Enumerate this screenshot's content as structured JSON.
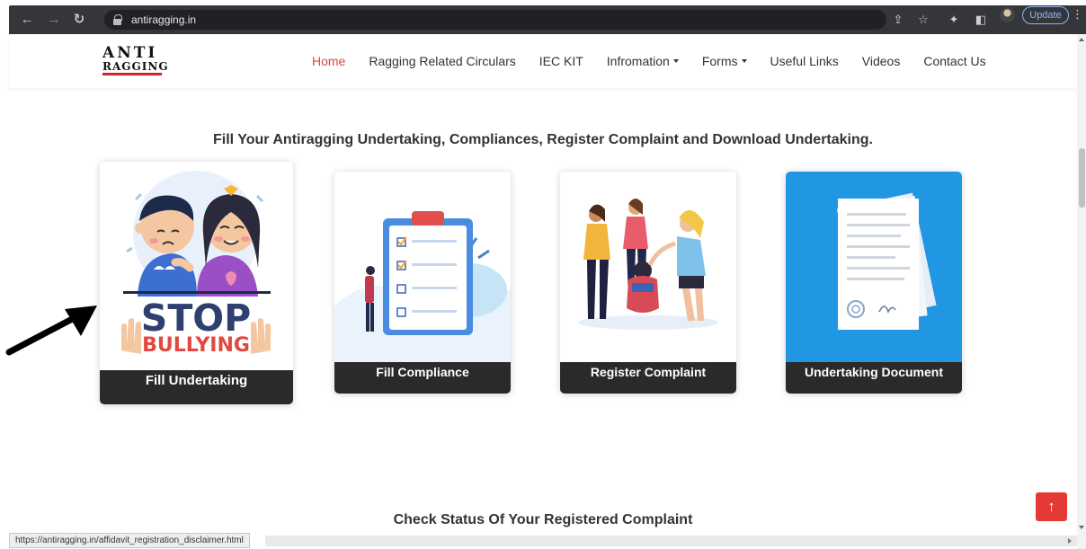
{
  "browser": {
    "url": "antiragging.in",
    "update_label": "Update",
    "status_url": "https://antiragging.in/affidavit_registration_disclaimer.html"
  },
  "logo": {
    "line1": "ANTI",
    "line2": "RAGGING"
  },
  "nav": {
    "items": [
      {
        "label": "Home",
        "active": true
      },
      {
        "label": "Ragging Related Circulars"
      },
      {
        "label": "IEC KIT"
      },
      {
        "label": "Infromation",
        "dropdown": true
      },
      {
        "label": "Forms",
        "dropdown": true
      },
      {
        "label": "Useful Links"
      },
      {
        "label": "Videos"
      },
      {
        "label": "Contact Us"
      }
    ]
  },
  "headline": "Fill Your Antiragging Undertaking, Compliances, Register Complaint and Download Undertaking.",
  "cards": [
    {
      "label": "Fill Undertaking",
      "poster_line1": "STOP",
      "poster_line2": "BULLYING"
    },
    {
      "label": "Fill Compliance"
    },
    {
      "label": "Register Complaint"
    },
    {
      "label": "Undertaking Document"
    }
  ],
  "bottom_heading": "Check Status Of Your Registered Complaint",
  "colors": {
    "accent": "#d9473f",
    "card_label_bg": "#2a2a2a",
    "doc_bg": "#2196e3",
    "to_top": "#e53935"
  }
}
